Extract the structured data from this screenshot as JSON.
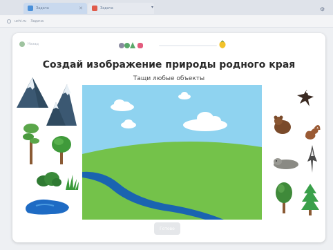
{
  "browser": {
    "tabs": [
      {
        "label": "Задача",
        "active": true
      },
      {
        "label": "Задача",
        "active": false
      }
    ],
    "address_items": [
      "uchi.ru",
      "Задача"
    ]
  },
  "task": {
    "back_label": "Назад",
    "title": "Создай изображение природы родного края",
    "subtitle": "Тащи любые объекты",
    "done_label": "Готово",
    "progress_fraction": 0.55
  },
  "colors": {
    "sky": "#8fd3f0",
    "grass": "#74c24a",
    "river": "#1a64b0",
    "cloud": "#ffffff",
    "accent_green": "#59a86a"
  },
  "stickers_left": [
    "mountain-icon",
    "mountain-range-icon",
    "pine-tree-icon",
    "birch-tree-icon",
    "bush-icon",
    "grass-tuft-icon",
    "pond-icon"
  ],
  "stickers_right": [
    "eagle-icon",
    "bear-icon",
    "squirrel-icon",
    "seal-icon",
    "bird-icon",
    "oak-tree-icon",
    "fir-tree-icon"
  ]
}
